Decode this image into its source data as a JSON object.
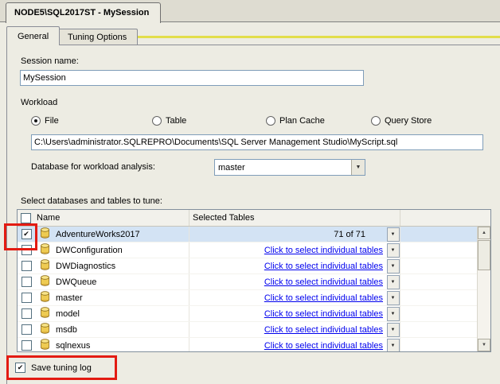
{
  "window": {
    "doc_tab_title": "NODE5\\SQL2017ST - MySession"
  },
  "tabs": [
    {
      "label": "General",
      "selected": true
    },
    {
      "label": "Tuning Options",
      "selected": false
    }
  ],
  "general": {
    "session_name_label": "Session name:",
    "session_name_value": "MySession",
    "workload": {
      "label": "Workload",
      "options": [
        {
          "label": "File",
          "selected": true
        },
        {
          "label": "Table",
          "selected": false
        },
        {
          "label": "Plan Cache",
          "selected": false
        },
        {
          "label": "Query Store",
          "selected": false
        }
      ],
      "file_path": "C:\\Users\\administrator.SQLREPRO\\Documents\\SQL Server Management Studio\\MyScript.sql",
      "database_label": "Database for workload analysis:",
      "database_value": "master"
    },
    "grid_label": "Select databases and tables to tune:",
    "grid": {
      "columns": [
        "Name",
        "Selected Tables"
      ],
      "rows": [
        {
          "name": "AdventureWorks2017",
          "checked": true,
          "selected": true,
          "tables": "71 of 71",
          "link": false
        },
        {
          "name": "DWConfiguration",
          "checked": false,
          "selected": false,
          "tables": "Click to select individual tables",
          "link": true
        },
        {
          "name": "DWDiagnostics",
          "checked": false,
          "selected": false,
          "tables": "Click to select individual tables",
          "link": true
        },
        {
          "name": "DWQueue",
          "checked": false,
          "selected": false,
          "tables": "Click to select individual tables",
          "link": true
        },
        {
          "name": "master",
          "checked": false,
          "selected": false,
          "tables": "Click to select individual tables",
          "link": true
        },
        {
          "name": "model",
          "checked": false,
          "selected": false,
          "tables": "Click to select individual tables",
          "link": true
        },
        {
          "name": "msdb",
          "checked": false,
          "selected": false,
          "tables": "Click to select individual tables",
          "link": true
        },
        {
          "name": "sqlnexus",
          "checked": false,
          "selected": false,
          "tables": "Click to select individual tables",
          "link": true
        }
      ]
    },
    "save_tuning_log_label": "Save tuning log",
    "save_tuning_log_checked": true
  }
}
